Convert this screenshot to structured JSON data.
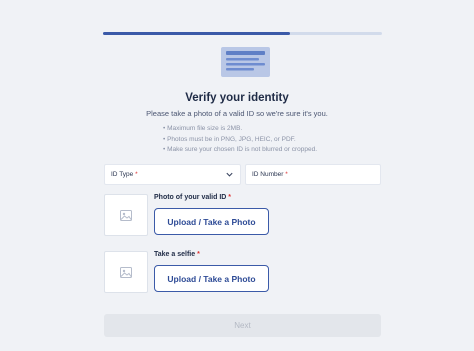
{
  "progress": {
    "fraction": 0.67
  },
  "illustration": {
    "icon": "id-card-icon"
  },
  "header": {
    "title": "Verify your identity",
    "subtitle": "Please take a photo of a valid ID so we're sure it's you."
  },
  "requirements": [
    "Maximum file size is 2MB.",
    "Photos must be in PNG, JPG, HEIC, or PDF.",
    "Make sure your chosen ID is not blurred or cropped."
  ],
  "fields": {
    "id_type": {
      "label": "ID Type",
      "required_mark": "*",
      "icon": "chevron-down-icon"
    },
    "id_number": {
      "label": "ID Number",
      "required_mark": "*"
    }
  },
  "uploads": {
    "id_photo": {
      "label": "Photo of your valid ID",
      "required_mark": "*",
      "button": "Upload / Take a Photo",
      "icon": "image-placeholder-icon"
    },
    "selfie": {
      "label": "Take a selfie",
      "required_mark": "*",
      "button": "Upload / Take a Photo",
      "icon": "image-placeholder-icon"
    }
  },
  "actions": {
    "next": "Next"
  },
  "colors": {
    "accent": "#3b5aa8",
    "background": "#f0f2f6",
    "disabled": "#e3e6eb"
  }
}
